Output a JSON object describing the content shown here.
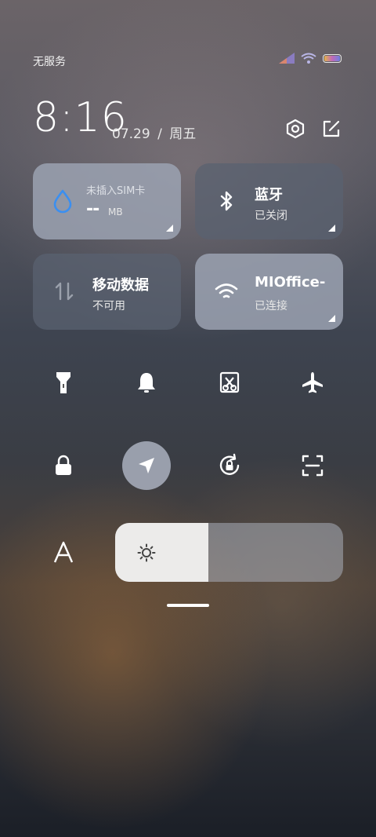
{
  "status": {
    "carrier": "无服务"
  },
  "header": {
    "time": "8:16",
    "date": "07.29",
    "sep": "/",
    "weekday": "周五"
  },
  "tiles": {
    "sim": {
      "title": "未插入SIM卡",
      "value": "--",
      "unit": "MB"
    },
    "bluetooth": {
      "title": "蓝牙",
      "status": "已关闭"
    },
    "mobile_data": {
      "title": "移动数据",
      "status": "不可用"
    },
    "wifi": {
      "title": "MIOffice-",
      "status": "已连接"
    }
  },
  "quick": [
    {
      "name": "flashlight-icon"
    },
    {
      "name": "bell-icon"
    },
    {
      "name": "screenshot-icon"
    },
    {
      "name": "airplane-icon"
    },
    {
      "name": "lock-icon"
    },
    {
      "name": "location-icon",
      "active": true
    },
    {
      "name": "rotation-lock-icon"
    },
    {
      "name": "scanner-icon"
    }
  ],
  "brightness": {
    "level": 0.41
  },
  "colors": {
    "tile_dark": "#5a6270",
    "tile_light": "#9ba2b2",
    "accent_blue": "#3b8ff0"
  }
}
